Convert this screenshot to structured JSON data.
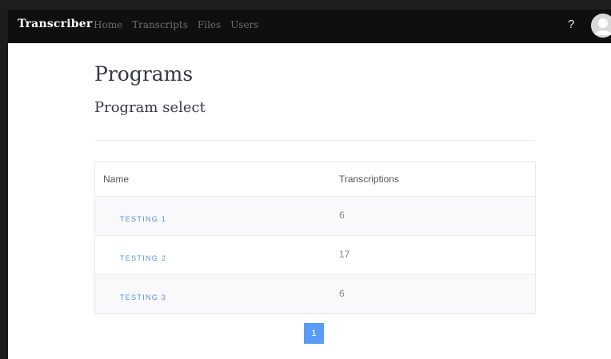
{
  "navbar": {
    "brand": "Transcriber",
    "links": [
      "Home",
      "Transcripts",
      "Files",
      "Users"
    ],
    "help_label": "?"
  },
  "page": {
    "title": "Programs",
    "subtitle": "Program select"
  },
  "table": {
    "headers": [
      "Name",
      "Transcriptions"
    ],
    "rows": [
      {
        "name": "TESTING 1",
        "transcriptions": "6"
      },
      {
        "name": "TESTING 2",
        "transcriptions": "17"
      },
      {
        "name": "TESTING 3",
        "transcriptions": "6"
      }
    ]
  },
  "pagination": {
    "current_page": "1"
  },
  "colors": {
    "navbar_bg": "#0f0f0f",
    "link": "#5b8fd6",
    "pager": "#5b9bf8"
  }
}
